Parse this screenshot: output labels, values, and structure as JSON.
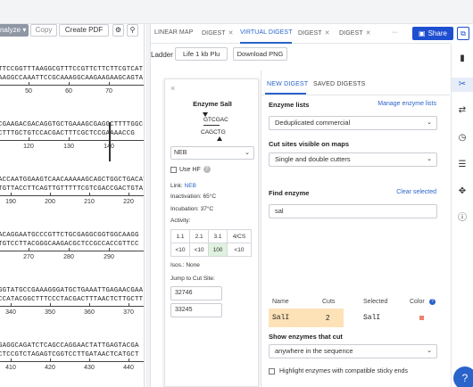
{
  "toolbar": {
    "analyze_label": "Analyze",
    "copy_label": "Copy",
    "create_pdf_label": "Create PDF",
    "gear_icon": "gear-icon",
    "zoom_icon": "zoom-icon"
  },
  "sequence": {
    "blocks": [
      {
        "top": "TTCCGGTTTAAGGCGTTTCCGTTCTTCTTCGTCAT",
        "bottom": "AAGGCCAAATTCCGCAAAGGCAAGAAGAAGCAGTA",
        "ticks": [
          "50",
          "60",
          "70"
        ]
      },
      {
        "top": "CGAAGACGACAGGTGCTGAAAGCGAGGCTTTTGGC",
        "bottom": "CTTTGCTGTCCACGACTTTCGCTCCGAAAACCG",
        "ticks": [
          "120",
          "130",
          "140"
        ]
      },
      {
        "top": "ACCAATGGAAGTCAACAAAAAGCAGCTGGCTGACAT",
        "bottom": "TGTTACCTTCAGTTGTTTTTCGTCGACCGACTGTA",
        "ticks": [
          "190",
          "200",
          "210",
          "220"
        ]
      },
      {
        "top": "ACAGGAATGCCCGTTCTGCGAGGCGGTGGCAAGG",
        "bottom": "TGTCCTTACGGGCAAGACGCTCCGCCACCGTTCC",
        "ticks": [
          "270",
          "280",
          "290"
        ]
      },
      {
        "top": "GGTATGCCGAAAGGGATGCTGAAATTGAGAACGAA",
        "bottom": "CCATACGGCTTTCCCTACGACTTTAACTCTTGCTT",
        "ticks": [
          "340",
          "350",
          "360",
          "370"
        ]
      },
      {
        "top": "GAGGCAGATCTCAGCCAGGAACTATTGAGTACGA",
        "bottom": "CTCCGTCTAGAGTCGGTCCTTGATAACTCATGCT",
        "ticks": [
          "410",
          "420",
          "430",
          "440"
        ]
      }
    ]
  },
  "tabs": [
    {
      "label": "LINEAR MAP",
      "closable": false,
      "active": false
    },
    {
      "label": "DIGEST",
      "closable": true,
      "active": false
    },
    {
      "label": "VIRTUAL DIGEST",
      "closable": false,
      "active": true
    },
    {
      "label": "DIGEST",
      "closable": true,
      "active": false
    },
    {
      "label": "DIGEST",
      "closable": true,
      "active": false
    }
  ],
  "tab_more": "···",
  "share": {
    "label": "Share"
  },
  "ladder": {
    "label": "Ladder",
    "selected": "Life 1 kb Plu",
    "download_label": "Download PNG"
  },
  "popup": {
    "title": "Enzyme SalI",
    "site_top": "GTCGAC",
    "site_bottom": "CAGCTG",
    "buffer": "NEB",
    "use_hf": "Use HF",
    "link_label": "Link:",
    "link_value": "NEB",
    "inactivation": "Inactivation: 65°C",
    "incubation": "Incubation: 37°C",
    "activity_label": "Activity:",
    "activity_headers": [
      "1.1",
      "2.1",
      "3.1",
      "4/CS"
    ],
    "activity_values": [
      "<10",
      "<10",
      "100",
      "<10"
    ],
    "isos": "Isos.: None",
    "jump_label": "Jump to Cut Site:",
    "cut_sites": [
      "32746",
      "33245"
    ],
    "close_icon": "close-icon"
  },
  "panel": {
    "tab_new": "NEW DIGEST",
    "tab_saved": "SAVED DIGESTS",
    "enzyme_lists_label": "Enzyme lists",
    "manage_link": "Manage enzyme lists",
    "enzyme_list_value": "Deduplicated commercial",
    "cut_sites_label": "Cut sites visible on maps",
    "cut_sites_value": "Single and double cutters",
    "find_label": "Find enzyme",
    "clear_link": "Clear selected",
    "search_value": "sal",
    "headers": {
      "name": "Name",
      "cuts": "Cuts",
      "selected": "Selected",
      "color": "Color"
    },
    "row": {
      "name": "SalI",
      "cuts": "2",
      "selected": "SalI",
      "color": "#f08070"
    },
    "show_cut_label": "Show enzymes that cut",
    "show_cut_value": "anywhere in the sequence",
    "highlight_label": "Highlight enzymes with compatible sticky ends"
  },
  "sidebar_icons": [
    "bookmark-icon",
    "scissors-icon",
    "swap-icon",
    "clock-icon",
    "list-icon",
    "move-icon",
    "info-icon"
  ],
  "colors": {
    "accent": "#2a63c9",
    "share": "#1e4fd1",
    "highlight_row": "#fde2b8",
    "activity_hl": "#dff2df"
  }
}
